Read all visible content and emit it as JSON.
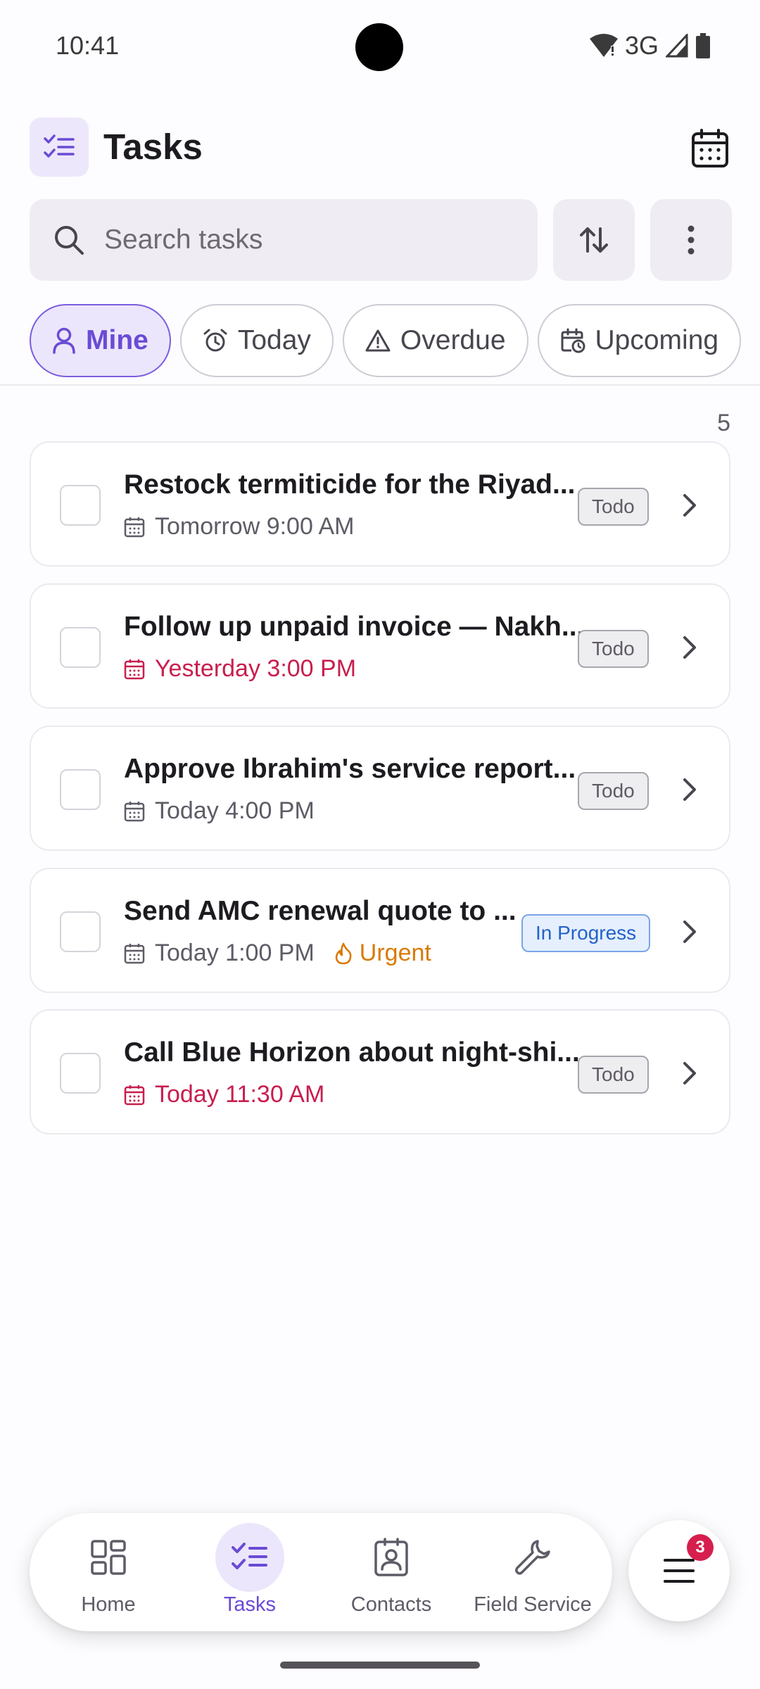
{
  "status_bar": {
    "time": "10:41",
    "network": "3G"
  },
  "header": {
    "title": "Tasks",
    "app_icon": "checklist-icon",
    "calendar_icon": "calendar-icon"
  },
  "search": {
    "placeholder": "Search tasks",
    "value": ""
  },
  "filters": [
    {
      "label": "Mine",
      "icon": "person-icon",
      "active": true
    },
    {
      "label": "Today",
      "icon": "alarm-icon",
      "active": false
    },
    {
      "label": "Overdue",
      "icon": "warning-icon",
      "active": false
    },
    {
      "label": "Upcoming",
      "icon": "calendar-clock-icon",
      "active": false
    }
  ],
  "task_count": "5",
  "tasks": [
    {
      "title": "Restock termiticide for the Riyad...",
      "due": "Tomorrow 9:00 AM",
      "overdue": false,
      "priority": "",
      "status": "Todo"
    },
    {
      "title": "Follow up unpaid invoice — Nakh...",
      "due": "Yesterday 3:00 PM",
      "overdue": true,
      "priority": "",
      "status": "Todo"
    },
    {
      "title": "Approve Ibrahim's service report...",
      "due": "Today 4:00 PM",
      "overdue": false,
      "priority": "",
      "status": "Todo"
    },
    {
      "title": "Send AMC renewal quote to ...",
      "due": "Today 1:00 PM",
      "overdue": false,
      "priority": "Urgent",
      "status": "In Progress"
    },
    {
      "title": "Call Blue Horizon about night-shi...",
      "due": "Today 11:30 AM",
      "overdue": true,
      "priority": "",
      "status": "Todo"
    }
  ],
  "bottom_nav": [
    {
      "label": "Home",
      "icon": "dashboard-icon",
      "active": false
    },
    {
      "label": "Tasks",
      "icon": "checklist-icon",
      "active": true
    },
    {
      "label": "Contacts",
      "icon": "contact-card-icon",
      "active": false
    },
    {
      "label": "Field Service",
      "icon": "wrench-icon",
      "active": false
    }
  ],
  "menu": {
    "icon": "hamburger-icon",
    "badge": "3"
  },
  "colors": {
    "accent": "#6a4bd4",
    "accent_bg": "#ece6fc",
    "overdue": "#c81e4e",
    "urgent": "#d97a06",
    "in_progress": "#2461c9"
  }
}
